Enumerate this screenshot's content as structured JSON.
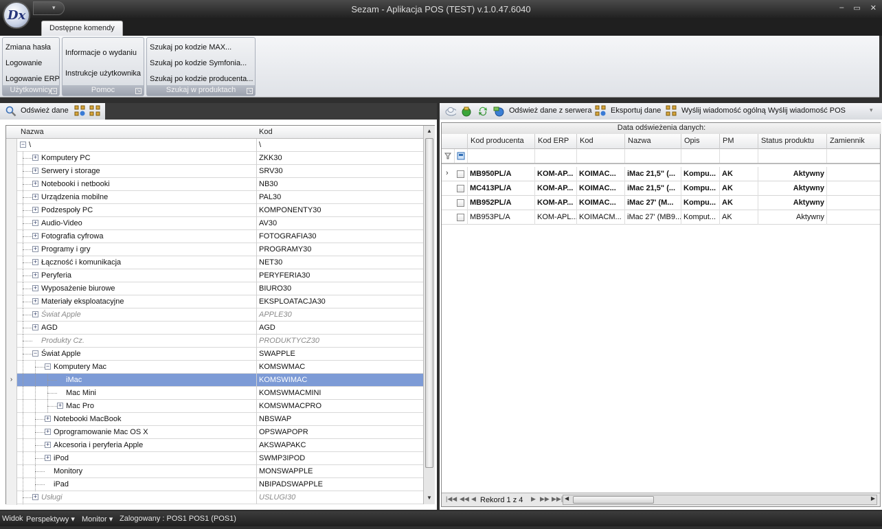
{
  "window": {
    "title": "Sezam - Aplikacja POS (TEST) v.1.0.47.6040",
    "logo_text": "Dx",
    "controls": [
      "–",
      "▭",
      "✕"
    ]
  },
  "ribbon": {
    "tab": "Dostępne komendy",
    "groups": [
      {
        "title": "Użytkownicy",
        "items": [
          "Zmiana hasła",
          "Logowanie",
          "Logowanie ERP"
        ]
      },
      {
        "title": "Pomoc",
        "items": [
          "Informacje o wydaniu",
          "Instrukcje użytkownika"
        ]
      },
      {
        "title": "Szukaj w produktach",
        "items": [
          "Szukaj po kodzie MAX...",
          "Szukaj po kodzie Symfonia...",
          "Szukaj po kodzie producenta..."
        ]
      }
    ]
  },
  "left": {
    "refresh_label": "Odśwież dane",
    "columns": {
      "name": "Nazwa",
      "code": "Kod"
    },
    "rows": [
      {
        "name": "\\",
        "code": "\\",
        "level": 0,
        "exp": "-",
        "state": ""
      },
      {
        "name": "Komputery PC",
        "code": "ZKK30",
        "level": 1,
        "exp": "+",
        "state": ""
      },
      {
        "name": "Serwery i storage",
        "code": "SRV30",
        "level": 1,
        "exp": "+",
        "state": ""
      },
      {
        "name": "Notebooki i netbooki",
        "code": "NB30",
        "level": 1,
        "exp": "+",
        "state": ""
      },
      {
        "name": "Urządzenia mobilne",
        "code": "PAL30",
        "level": 1,
        "exp": "+",
        "state": ""
      },
      {
        "name": "Podzespoły PC",
        "code": "KOMPONENTY30",
        "level": 1,
        "exp": "+",
        "state": ""
      },
      {
        "name": "Audio-Video",
        "code": "AV30",
        "level": 1,
        "exp": "+",
        "state": ""
      },
      {
        "name": "Fotografia cyfrowa",
        "code": "FOTOGRAFIA30",
        "level": 1,
        "exp": "+",
        "state": ""
      },
      {
        "name": "Programy i gry",
        "code": "PROGRAMY30",
        "level": 1,
        "exp": "+",
        "state": ""
      },
      {
        "name": "Łączność i komunikacja",
        "code": "NET30",
        "level": 1,
        "exp": "+",
        "state": ""
      },
      {
        "name": "Peryferia",
        "code": "PERYFERIA30",
        "level": 1,
        "exp": "+",
        "state": ""
      },
      {
        "name": "Wyposażenie biurowe",
        "code": "BIURO30",
        "level": 1,
        "exp": "+",
        "state": ""
      },
      {
        "name": "Materiały eksploatacyjne",
        "code": "EKSPLOATACJA30",
        "level": 1,
        "exp": "+",
        "state": ""
      },
      {
        "name": "Świat Apple",
        "code": "APPLE30",
        "level": 1,
        "exp": "+",
        "state": "dis"
      },
      {
        "name": "AGD",
        "code": "AGD",
        "level": 1,
        "exp": "+",
        "state": ""
      },
      {
        "name": "Produkty Cz.",
        "code": "PRODUKTYCZ30",
        "level": 1,
        "exp": "",
        "state": "dis"
      },
      {
        "name": "Świat Apple",
        "code": "SWAPPLE",
        "level": 1,
        "exp": "-",
        "state": ""
      },
      {
        "name": "Komputery Mac",
        "code": "KOMSWMAC",
        "level": 2,
        "exp": "-",
        "state": ""
      },
      {
        "name": "iMac",
        "code": "KOMSWIMAC",
        "level": 3,
        "exp": "",
        "state": "sel"
      },
      {
        "name": "Mac Mini",
        "code": "KOMSWMACMINI",
        "level": 3,
        "exp": "",
        "state": ""
      },
      {
        "name": "Mac Pro",
        "code": "KOMSWMACPRO",
        "level": 3,
        "exp": "+",
        "state": ""
      },
      {
        "name": "Notebooki MacBook",
        "code": "NBSWAP",
        "level": 2,
        "exp": "+",
        "state": ""
      },
      {
        "name": "Oprogramowanie Mac OS X",
        "code": "OPSWAPOPR",
        "level": 2,
        "exp": "+",
        "state": ""
      },
      {
        "name": "Akcesoria i peryferia Apple",
        "code": "AKSWAPAKC",
        "level": 2,
        "exp": "+",
        "state": ""
      },
      {
        "name": "iPod",
        "code": "SWMP3IPOD",
        "level": 2,
        "exp": "+",
        "state": ""
      },
      {
        "name": "Monitory",
        "code": "MONSWAPPLE",
        "level": 2,
        "exp": "",
        "state": ""
      },
      {
        "name": "iPad",
        "code": "NBIPADSWAPPLE",
        "level": 2,
        "exp": "",
        "state": ""
      },
      {
        "name": "Usługi",
        "code": "USLUGI30",
        "level": 1,
        "exp": "+",
        "state": "dis"
      }
    ]
  },
  "right": {
    "toolbar": {
      "refresh_server": "Odśwież dane z serwera",
      "export": "Eksportuj dane",
      "send_general": "Wyślij wiadomość ogólną",
      "send_pos": "Wyślij wiadomość POS"
    },
    "caption": "Data odświeżenia danych:",
    "columns": [
      "Kod producenta",
      "Kod ERP",
      "Kod",
      "Nazwa",
      "Opis",
      "PM",
      "Status produktu",
      "Zamiennik"
    ],
    "rows": [
      {
        "cells": [
          "MB950PL/A",
          "KOM-AP...",
          "KOIMAC...",
          "iMac 21,5\" (...",
          "Kompu...",
          "AK",
          "Aktywny",
          ""
        ],
        "bold": true,
        "current": true
      },
      {
        "cells": [
          "MC413PL/A",
          "KOM-AP...",
          "KOIMAC...",
          "iMac 21,5\" (...",
          "Kompu...",
          "AK",
          "Aktywny",
          ""
        ],
        "bold": true,
        "current": false
      },
      {
        "cells": [
          "MB952PL/A",
          "KOM-AP...",
          "KOIMAC...",
          "iMac 27' (M...",
          "Kompu...",
          "AK",
          "Aktywny",
          ""
        ],
        "bold": true,
        "current": false
      },
      {
        "cells": [
          "MB953PL/A",
          "KOM-APL...",
          "KOIMACM...",
          "iMac 27' (MB9...",
          "Komput...",
          "AK",
          "Aktywny",
          ""
        ],
        "bold": false,
        "current": false
      }
    ],
    "footer": {
      "record": "Rekord 1 z 4"
    }
  },
  "statusbar": {
    "view": "Widok",
    "perspectives": "Perspektywy ▾",
    "monitor": "Monitor ▾",
    "logged": "Zalogowany : POS1 POS1 (POS1)"
  }
}
